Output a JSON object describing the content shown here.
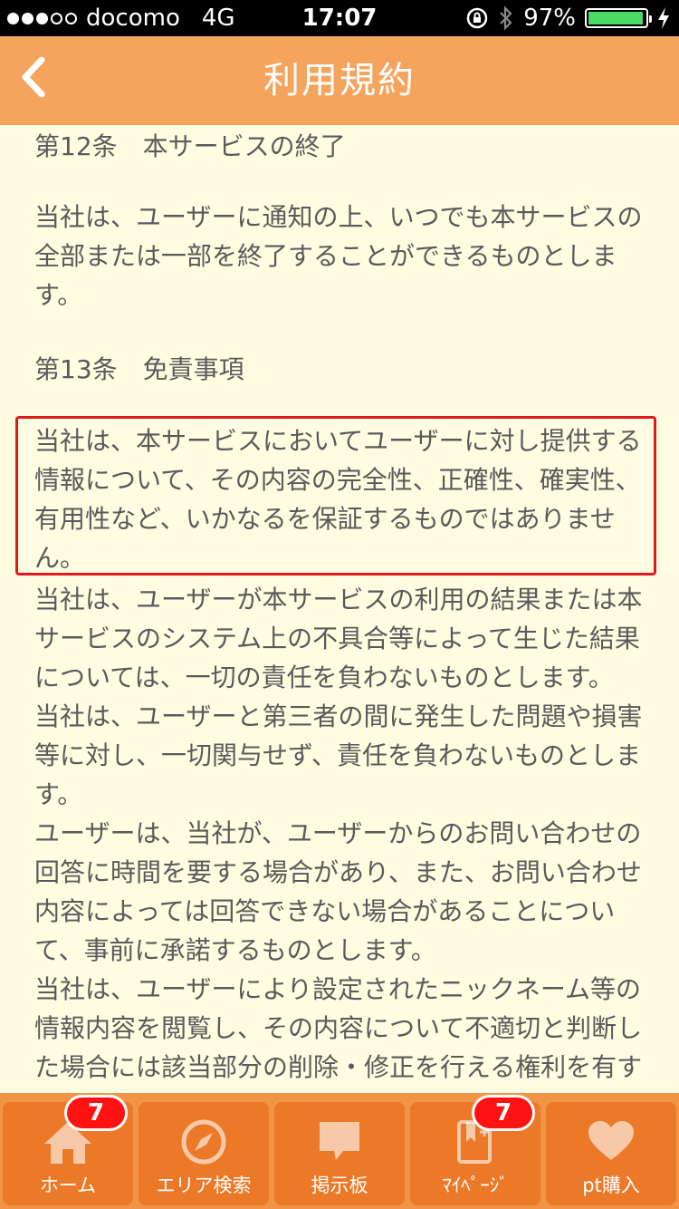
{
  "status_bar": {
    "carrier": "docomo",
    "network": "4G",
    "time": "17:07",
    "battery": "97%",
    "battery_level": 0.97,
    "signal_bars": 3
  },
  "nav": {
    "title": "利用規約",
    "back_icon": "chevron-left-icon"
  },
  "content": {
    "article12_heading": "第12条　本サービスの終了",
    "article12_body": "当社は、ユーザーに通知の上、いつでも本サービスの全部または一部を終了することができるものとします。",
    "article13_heading": "第13条　免責事項",
    "article13_p1": "当社は、本サービスにおいてユーザーに対し提供する情報について、その内容の完全性、正確性、確実性、有用性など、いかなるを保証するものではありません。",
    "article13_p2": "当社は、ユーザーが本サービスの利用の結果または本サービスのシステム上の不具合等によって生じた結果については、一切の責任を負わないものとします。",
    "article13_p3": "当社は、ユーザーと第三者の間に発生した問題や損害等に対し、一切関与せず、責任を負わないものとします。",
    "article13_p4": "ユーザーは、当社が、ユーザーからのお問い合わせの回答に時間を要する場合があり、また、お問い合わせ内容によっては回答できない場合があることについて、事前に承諾するものとします。",
    "article13_p5": "当社は、ユーザーにより設定されたニックネーム等の情報内容を閲覧し、その内容について不適切と判断した場合には該当部分の削除・修正を行える権利を有す"
  },
  "tabs": [
    {
      "label": "ホーム",
      "icon": "home-icon",
      "badge": "7"
    },
    {
      "label": "エリア検索",
      "icon": "compass-icon",
      "badge": ""
    },
    {
      "label": "掲示板",
      "icon": "speech-bubble-icon",
      "badge": ""
    },
    {
      "label": "ﾏｲﾍﾟｰｼﾞ",
      "icon": "bookmark-book-icon",
      "badge": "7"
    },
    {
      "label": "pt購入",
      "icon": "heart-icon",
      "badge": ""
    }
  ],
  "colors": {
    "nav_bg": "#f5a45d",
    "tab_bar_bg": "#f29446",
    "tab_bg": "#ec7928",
    "content_bg": "#fefde1",
    "highlight_border": "#e0191f",
    "badge_bg": "#ff1212"
  }
}
